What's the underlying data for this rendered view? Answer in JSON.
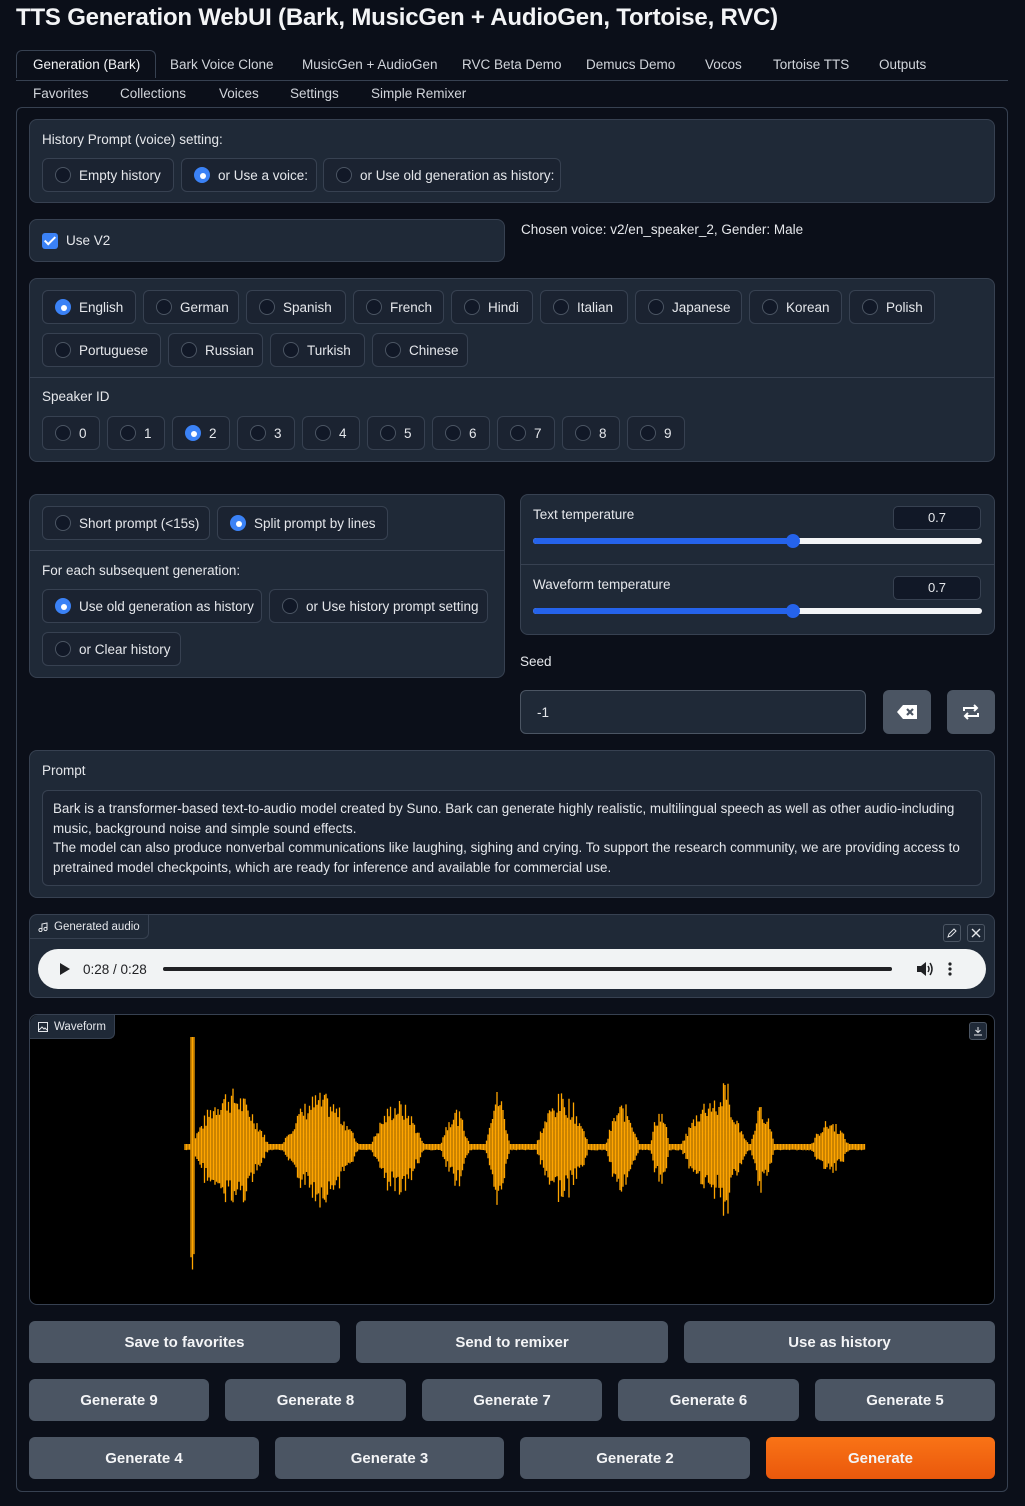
{
  "app": {
    "title": "TTS Generation WebUI (Bark, MusicGen + AudioGen, Tortoise, RVC)"
  },
  "tabs": [
    {
      "label": "Generation (Bark)",
      "active": true
    },
    {
      "label": "Bark Voice Clone"
    },
    {
      "label": "MusicGen + AudioGen"
    },
    {
      "label": "RVC Beta Demo"
    },
    {
      "label": "Demucs Demo"
    },
    {
      "label": "Vocos"
    },
    {
      "label": "Tortoise TTS"
    },
    {
      "label": "Outputs"
    },
    {
      "label": "Favorites"
    },
    {
      "label": "Collections"
    },
    {
      "label": "Voices"
    },
    {
      "label": "Settings"
    },
    {
      "label": "Simple Remixer"
    }
  ],
  "history_prompt": {
    "label": "History Prompt (voice) setting:",
    "options": [
      "Empty history",
      "or Use a voice:",
      "or Use old generation as history:"
    ],
    "selected": "or Use a voice:"
  },
  "use_v2": {
    "label": "Use V2",
    "checked": true
  },
  "chosen_voice": "Chosen voice: v2/en_speaker_2, Gender: Male",
  "languages": {
    "options": [
      "English",
      "German",
      "Spanish",
      "French",
      "Hindi",
      "Italian",
      "Japanese",
      "Korean",
      "Polish",
      "Portuguese",
      "Russian",
      "Turkish",
      "Chinese"
    ],
    "selected": "English"
  },
  "speaker_id": {
    "label": "Speaker ID",
    "options": [
      "0",
      "1",
      "2",
      "3",
      "4",
      "5",
      "6",
      "7",
      "8",
      "9"
    ],
    "selected": "2"
  },
  "prompt_mode": {
    "options": [
      "Short prompt (<15s)",
      "Split prompt by lines"
    ],
    "selected": "Split prompt by lines"
  },
  "subsequent": {
    "label": "For each subsequent generation:",
    "options": [
      "Use old generation as history",
      "or Use history prompt setting",
      "or Clear history"
    ],
    "selected": "Use old generation as history"
  },
  "text_temperature": {
    "label": "Text temperature",
    "value": "0.7",
    "fraction": 0.58
  },
  "waveform_temperature": {
    "label": "Waveform temperature",
    "value": "0.7",
    "fraction": 0.58
  },
  "seed": {
    "label": "Seed",
    "value": "-1"
  },
  "prompt": {
    "label": "Prompt",
    "text": "Bark is a transformer-based text-to-audio model created by Suno. Bark can generate highly realistic, multilingual speech as well as other audio-including music, background noise and simple sound effects.\nThe model can also produce nonverbal communications like laughing, sighing and crying. To support the research community, we are providing access to pretrained model checkpoints, which are ready for inference and available for commercial use."
  },
  "generated_audio": {
    "label": "Generated audio",
    "time": "0:28 / 0:28",
    "progress": 1.0
  },
  "waveform": {
    "label": "Waveform",
    "color": "#ffa500"
  },
  "actions": [
    "Save to favorites",
    "Send to remixer",
    "Use as history"
  ],
  "generate_row1": [
    "Generate 9",
    "Generate 8",
    "Generate 7",
    "Generate 6",
    "Generate 5"
  ],
  "generate_row2": [
    "Generate 4",
    "Generate 3",
    "Generate 2",
    "Generate"
  ],
  "colors": {
    "accent": "#3b82f6",
    "primary_button": "#f97316",
    "background": "#0b0f19",
    "panel": "#1f2937"
  }
}
